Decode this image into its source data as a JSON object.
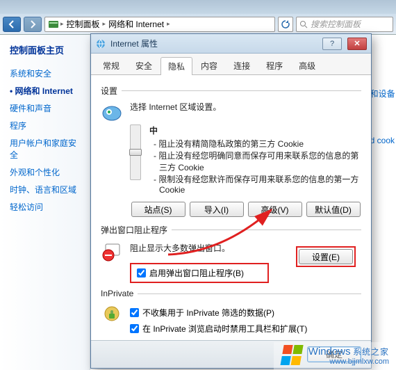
{
  "path": {
    "seg1": "控制面板",
    "seg2": "网络和 Internet"
  },
  "search": {
    "placeholder": "搜索控制面板"
  },
  "sidebar": {
    "title": "控制面板主页",
    "items": [
      "系统和安全",
      "网络和 Internet",
      "硬件和声音",
      "程序",
      "用户帐户和家庭安全",
      "外观和个性化",
      "时钟、语言和区域",
      "轻松访问"
    ]
  },
  "dialog": {
    "title": "Internet 属性",
    "tabs": [
      "常规",
      "安全",
      "隐私",
      "内容",
      "连接",
      "程序",
      "高级"
    ],
    "settings_hdr": "设置",
    "settings_desc": "选择 Internet 区域设置。",
    "slider_level": "中",
    "bullets": [
      "- 阻止没有精简隐私政策的第三方 Cookie",
      "- 阻止没有经您明确同意而保存可用来联系您的信息的第三方 Cookie",
      "- 限制没有经您默许而保存可用来联系您的信息的第一方 Cookie"
    ],
    "btn_sites": "站点(S)",
    "btn_import": "导入(I)",
    "btn_advanced": "高级(V)",
    "btn_default": "默认值(D)",
    "popup_hdr": "弹出窗口阻止程序",
    "popup_desc": "阻止显示大多数弹出窗口。",
    "popup_settings": "设置(E)",
    "popup_enable": "启用弹出窗口阻止程序(B)",
    "inprivate_hdr": "InPrivate",
    "inp_chk1": "不收集用于 InPrivate 筛选的数据(P)",
    "inp_chk2": "在 InPrivate 浏览启动时禁用工具栏和扩展(T)",
    "ok": "确定"
  },
  "peek": {
    "l1": "i和设备",
    "l2": "id cook"
  },
  "watermark": {
    "brand": "Windows",
    "sub": "系统之家",
    "url": "www.bjjmlxw.com"
  }
}
